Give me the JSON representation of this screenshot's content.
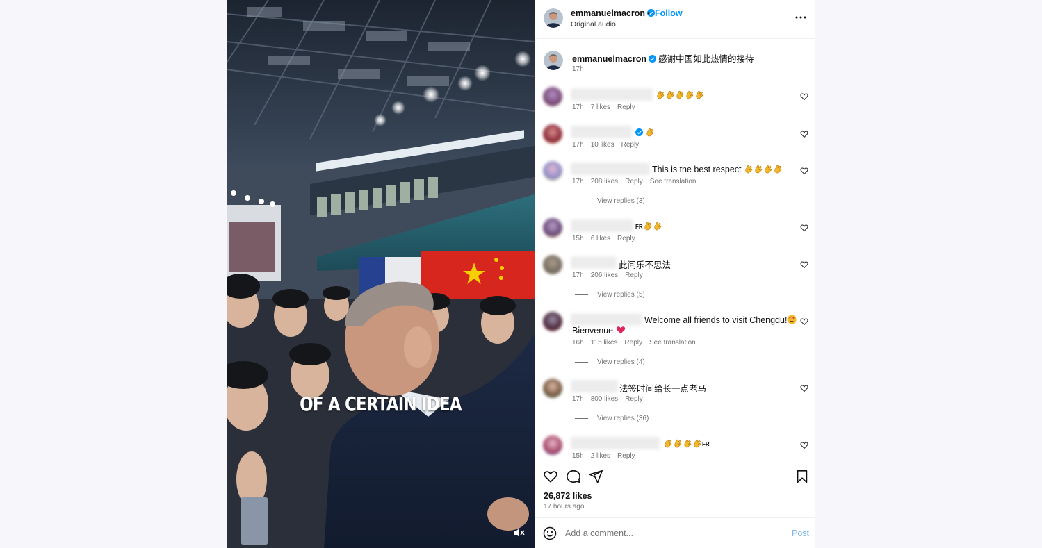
{
  "colors": {
    "accent": "#0095f6",
    "verified": "#0095f6",
    "muted_text": "#737373",
    "clap_emoji": "#f4b92a",
    "heart_emoji": "#e0245e",
    "flag_blue": "#25418f",
    "flag_red": "#d7261e"
  },
  "post": {
    "username": "emmanuelmacron",
    "follow_label": "Follow",
    "separator": "•",
    "audio_label": "Original audio",
    "more_icon": "more-horizontal-icon",
    "video_caption": "OF A CERTAIN IDEA",
    "mute_icon": "speaker-muted-icon"
  },
  "caption": {
    "username": "emmanuelmacron",
    "text": "感谢中国如此热情的接待",
    "time": "17h"
  },
  "comments": [
    {
      "text": "",
      "claps": 5,
      "time": "17h",
      "likes": "7 likes",
      "reply": "Reply"
    },
    {
      "text": "",
      "claps": 1,
      "verified": true,
      "time": "17h",
      "likes": "10 likes",
      "reply": "Reply"
    },
    {
      "text": "This is the best respect",
      "claps": 4,
      "time": "17h",
      "likes": "208 likes",
      "reply": "Reply",
      "see_translation": "See translation",
      "view_replies": "View replies (3)"
    },
    {
      "text": "",
      "fr_prefix": "FR",
      "claps": 2,
      "time": "15h",
      "likes": "6 likes",
      "reply": "Reply"
    },
    {
      "text": "此间乐不思法",
      "time": "17h",
      "likes": "206 likes",
      "reply": "Reply",
      "view_replies": "View replies (5)"
    },
    {
      "text": "Welcome all friends to visit Chengdu!",
      "text2": "Bienvenue",
      "time": "16h",
      "likes": "115 likes",
      "reply": "Reply",
      "see_translation": "See translation",
      "view_replies": "View replies (4)"
    },
    {
      "text": "法签时间给长一点老马",
      "time": "17h",
      "likes": "800 likes",
      "reply": "Reply",
      "view_replies": "View replies (36)"
    },
    {
      "text": "",
      "fr_suffix": "FR",
      "claps": 4,
      "time": "15h",
      "likes": "2 likes",
      "reply": "Reply"
    }
  ],
  "actions": {
    "like_icon": "heart-icon",
    "comment_icon": "comment-bubble-icon",
    "share_icon": "paper-plane-icon",
    "save_icon": "bookmark-icon",
    "likes": "26,872 likes",
    "time_ago": "17 hours ago"
  },
  "add_comment": {
    "placeholder": "Add a comment...",
    "post_label": "Post",
    "emoji_icon": "smiley-face-icon"
  }
}
